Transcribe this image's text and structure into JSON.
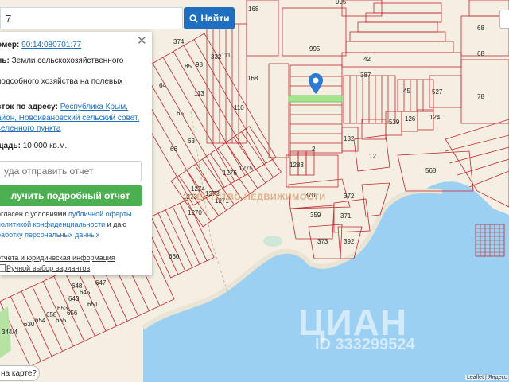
{
  "search": {
    "value": "7",
    "button_label": "Найти"
  },
  "panel": {
    "cadastral_prefix": "омер:",
    "cadastral_number": "90:14:080701:77",
    "category_prefix": "ль:",
    "category_line1": "Земли сельскохозяйственного",
    "category_line2": "подсобного хозяйства на полевых",
    "address_prefix": "сток по адресу:",
    "address_line1": "Республика Крым,",
    "address_line2": "айон, Новоивановский сельский совет,",
    "address_line3": "селенного пункта",
    "area_prefix": "щадь:",
    "area_value": "10 000 кв.м.",
    "email_placeholder": "уда отправить отчет",
    "get_report_label": "лучить подробный отчет",
    "consent_line1a": "огласен с условиями ",
    "consent_link1": "публичной оферты",
    "consent_line2": "политикой конфиденциальности",
    "consent_line2b": " и даю",
    "consent_line3": "работку персональных данных",
    "link_report": "отчета и юридическая информация",
    "link_manual": "Ручной выбор вариантов"
  },
  "map": {
    "parcels": [
      "995",
      "168",
      "995",
      "42",
      "387",
      "168",
      "45",
      "527",
      "539",
      "126",
      "124",
      "78",
      "68",
      "68",
      "2",
      "132",
      "12",
      "568",
      "1283",
      "370",
      "372",
      "359",
      "371",
      "373",
      "392",
      "1274",
      "1276",
      "1272",
      "1275",
      "1273",
      "1270",
      "1271",
      "64",
      "66",
      "63",
      "65",
      "374",
      "85",
      "98",
      "111",
      "332",
      "110",
      "113",
      "643",
      "645",
      "647",
      "648",
      "649",
      "344/4",
      "630",
      "660",
      "654",
      "658",
      "653",
      "655",
      "656",
      "651"
    ],
    "labels": [
      "ЦИАН",
      "ID 333299524",
      "АГЕНТСТВО НЕДВИЖИМОСТИ"
    ]
  },
  "bottom_pill": "на карте?",
  "attribution": "Leaflet | Яндекс",
  "colors": {
    "water": "#9cd0f2",
    "land": "#f4efe2",
    "parcel": "#c0272d",
    "accent": "#1e6fc1",
    "green": "#4caf50"
  }
}
